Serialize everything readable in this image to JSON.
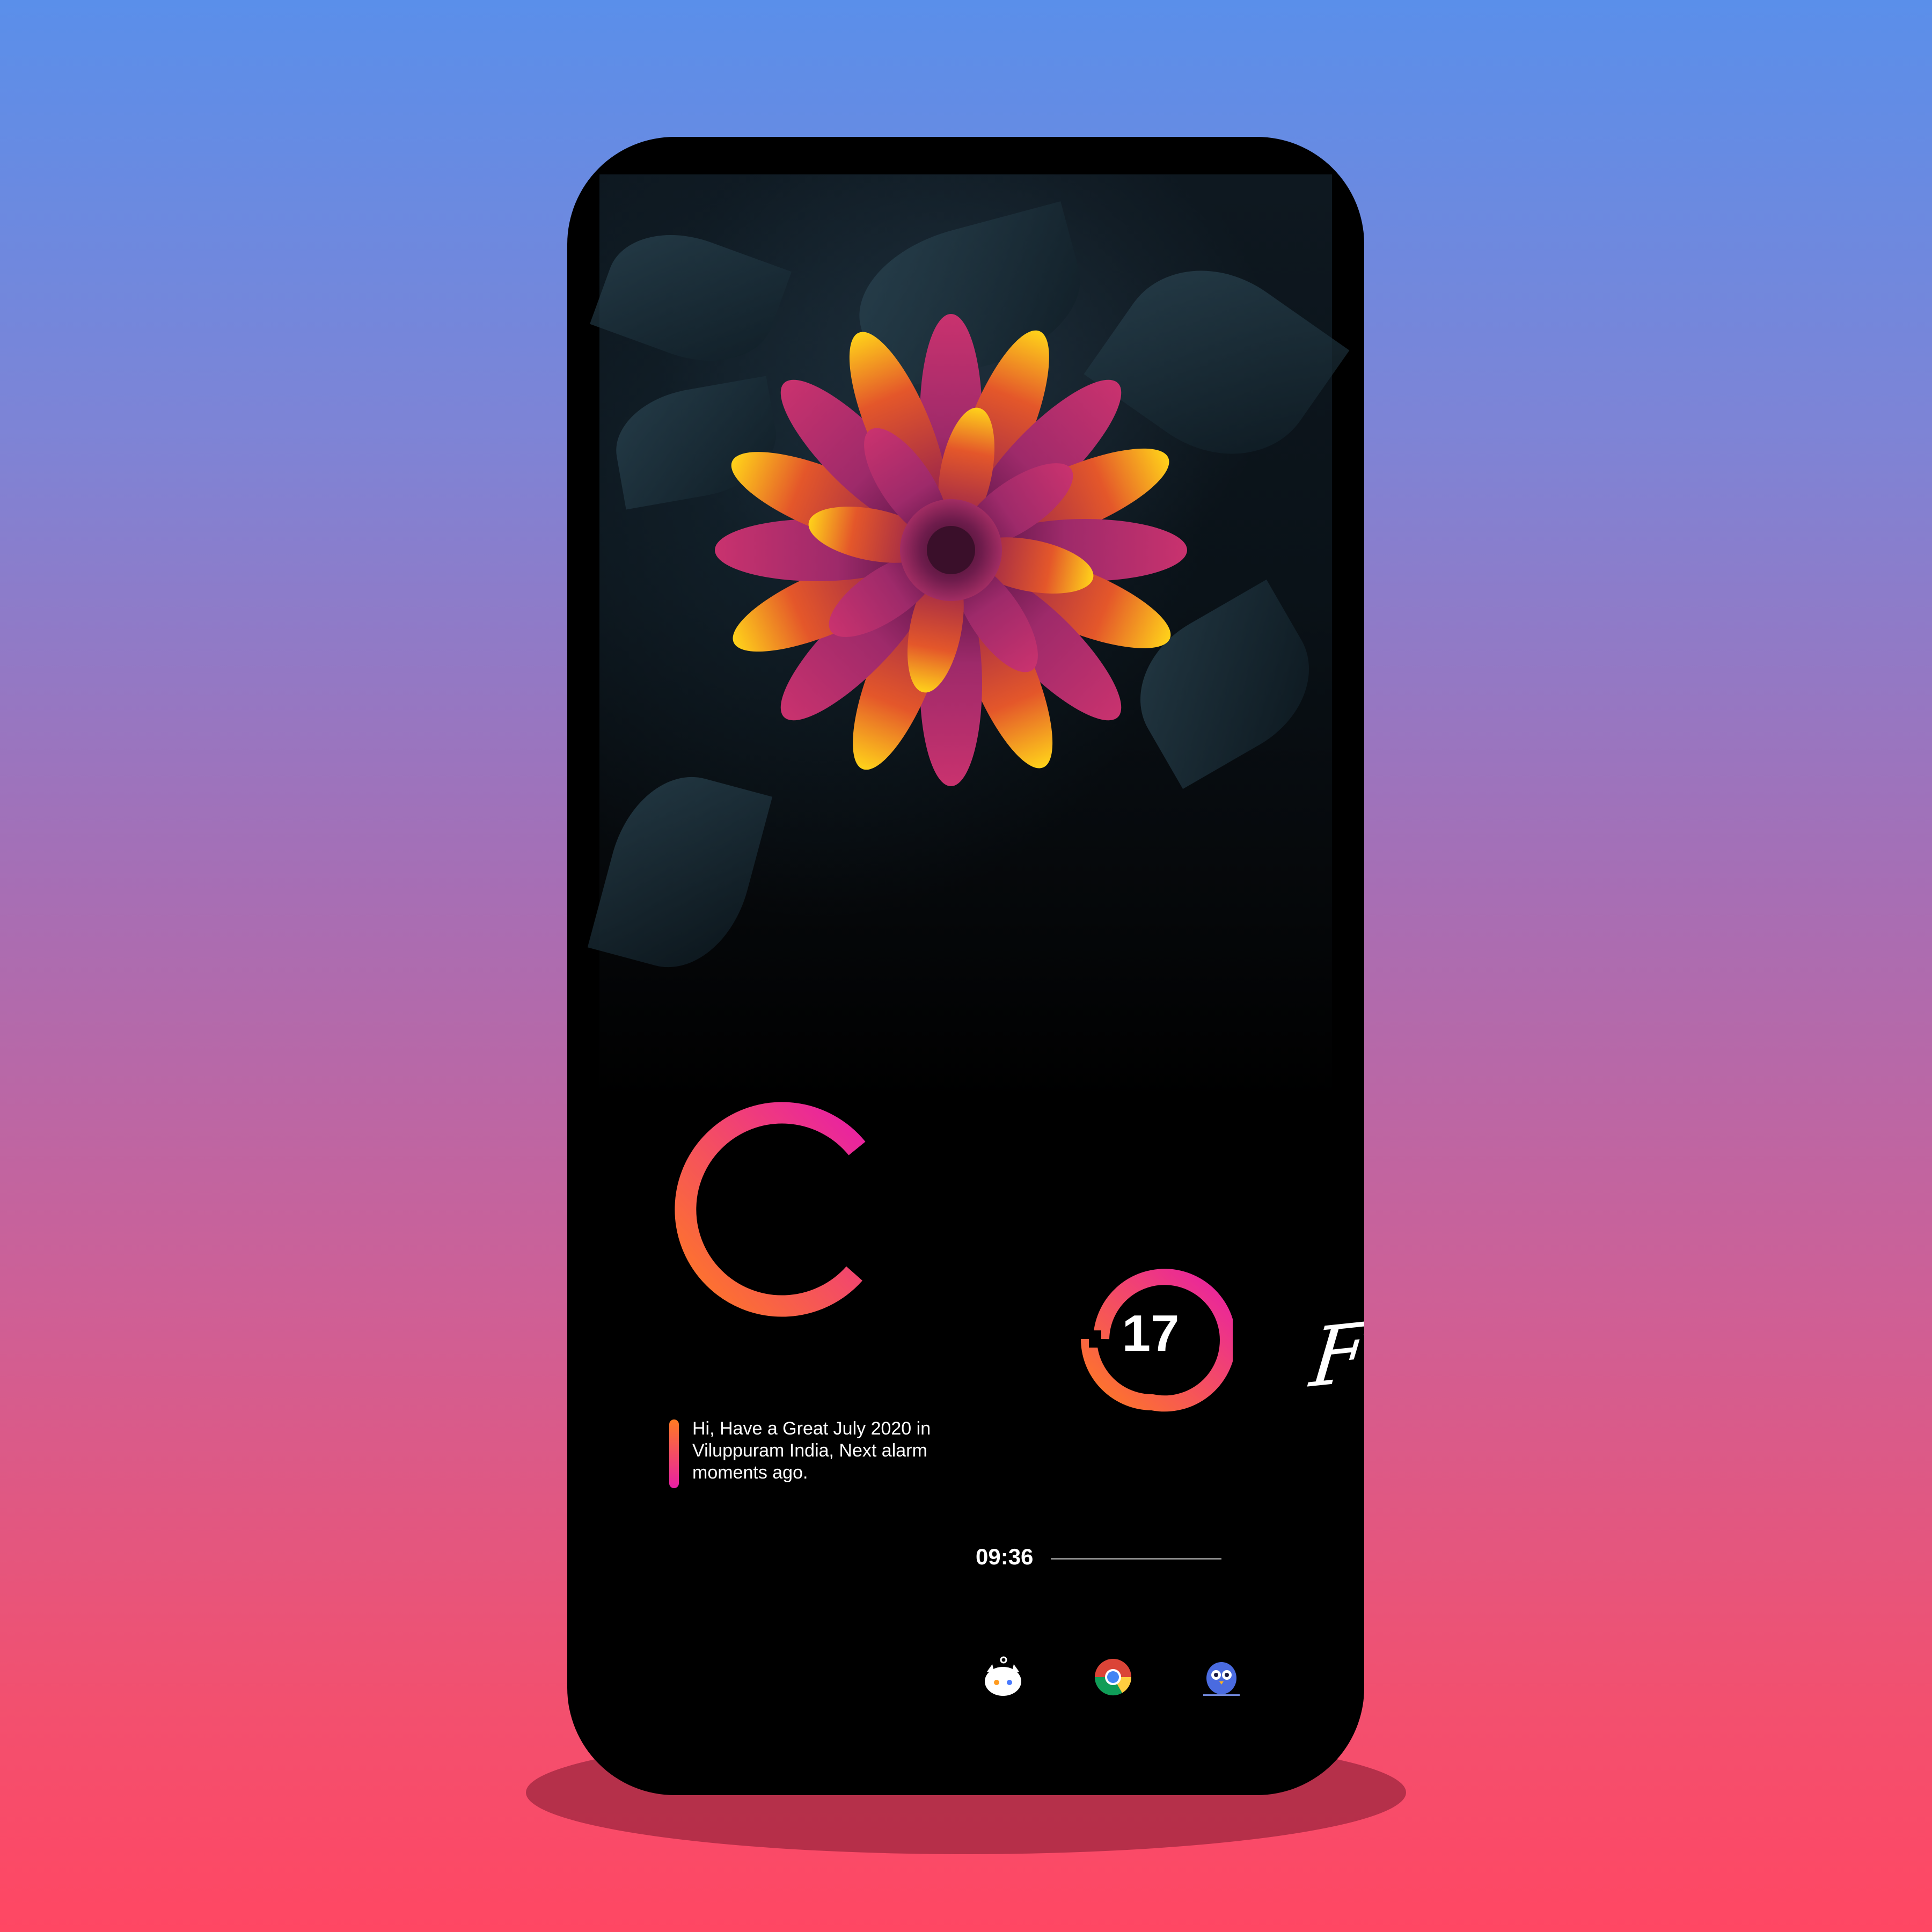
{
  "widget": {
    "day_name": "Friday",
    "day_number": "17",
    "greeting": "Hi, Have a Great July 2020 in Viluppuram India, Next alarm moments ago.",
    "time": "09:36"
  },
  "dock": {
    "icons": [
      "mascot-app-icon",
      "chrome-icon",
      "owl-app-icon"
    ]
  },
  "colors": {
    "ring_start": "#ff7b22",
    "ring_end": "#e81fa5",
    "screen_bg": "#000000"
  }
}
